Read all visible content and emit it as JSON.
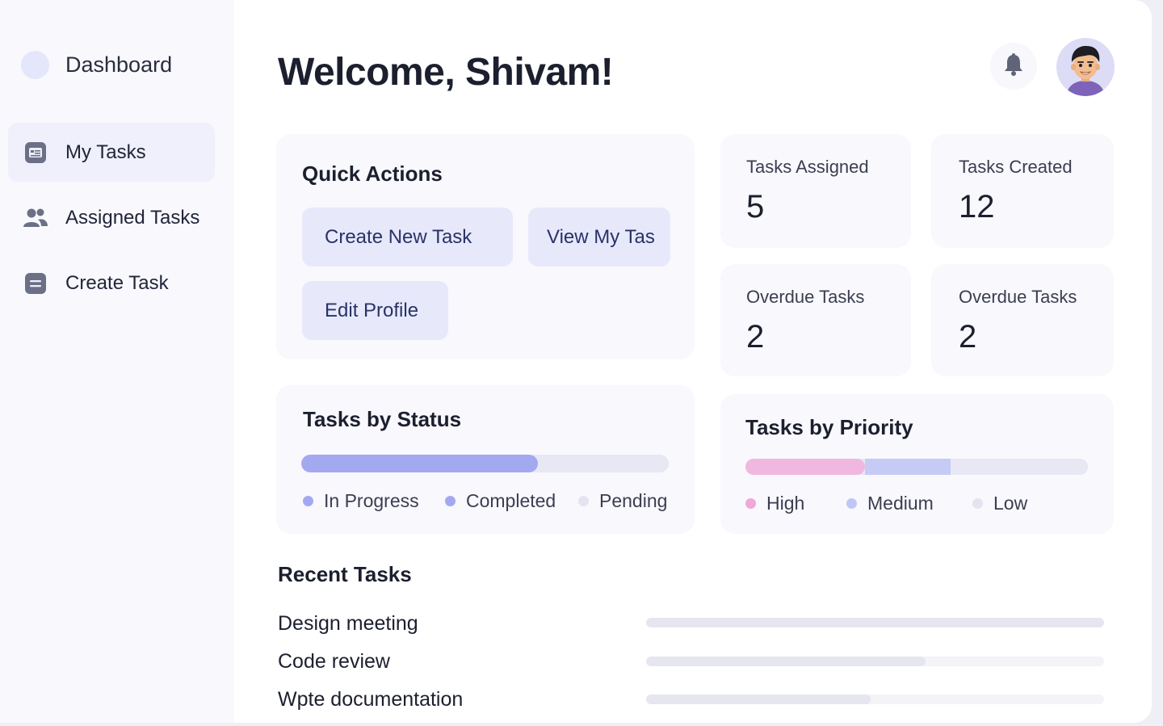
{
  "sidebar": {
    "brand": "Dashboard",
    "items": [
      {
        "label": "My Tasks",
        "icon": "task-list-icon",
        "active": true
      },
      {
        "label": "Assigned Tasks",
        "icon": "users-icon",
        "active": false
      },
      {
        "label": "Create Task",
        "icon": "document-icon",
        "active": false
      }
    ]
  },
  "header": {
    "title": "Welcome, Shivam!",
    "notification_icon": "bell-icon",
    "avatar_icon": "user-avatar-icon"
  },
  "quick_actions": {
    "title": "Quick Actions",
    "buttons": [
      "Create New Task",
      "View My Tas",
      "Edit Profile"
    ]
  },
  "stats": [
    {
      "label": "Tasks Assigned",
      "value": "5"
    },
    {
      "label": "Tasks Created",
      "value": "12"
    },
    {
      "label": "Overdue Tasks",
      "value": "2"
    },
    {
      "label": "Overdue Tasks",
      "value": "2"
    }
  ],
  "tasks_by_status": {
    "title": "Tasks by Status",
    "segments": [
      {
        "label": "In Progress",
        "fraction": 0.645,
        "color": "#a3a9f0"
      },
      {
        "label": "Completed",
        "fraction": 0.0,
        "color": "#a3a9f0"
      },
      {
        "label": "Pending",
        "fraction": 0.355,
        "color": "#e8e8f4"
      }
    ]
  },
  "tasks_by_priority": {
    "title": "Tasks by Priority",
    "segments": [
      {
        "label": "High",
        "fraction": 0.35,
        "color": "#f0b8e0"
      },
      {
        "label": "Medium",
        "fraction": 0.25,
        "color": "#c5cbf4"
      },
      {
        "label": "Low",
        "fraction": 0.4,
        "color": "#e8e8f4"
      }
    ]
  },
  "recent_tasks": {
    "title": "Recent Tasks",
    "items": [
      {
        "name": "Design meeting",
        "progress": 1.0
      },
      {
        "name": "Code review",
        "progress": 0.61
      },
      {
        "name": "Wpte documentation",
        "progress": 0.49
      }
    ]
  }
}
